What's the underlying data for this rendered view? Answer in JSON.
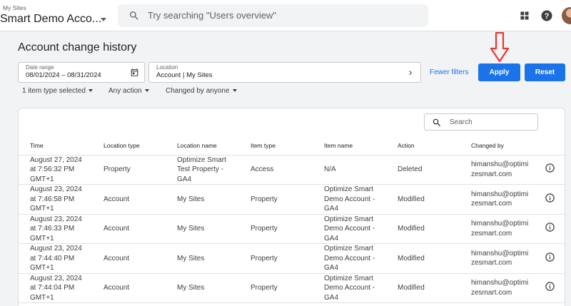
{
  "topbar": {
    "account_label": "My Sites",
    "account_name": "Smart Demo Acco...",
    "search_placeholder": "Try searching \"Users overview\""
  },
  "page": {
    "title": "Account change history"
  },
  "filters": {
    "date_range_label": "Date range",
    "date_range_value": "08/01/2024 – 08/31/2024",
    "location_label": "Location",
    "location_value": "Account | My Sites",
    "fewer_filters": "Fewer filters",
    "apply": "Apply",
    "reset": "Reset",
    "chips": [
      "1 item type selected",
      "Any action",
      "Changed by anyone"
    ]
  },
  "table": {
    "search_placeholder": "Search",
    "columns": [
      "Time",
      "Location type",
      "Location name",
      "Item type",
      "Item name",
      "Action",
      "Changed by"
    ],
    "rows": [
      {
        "time": [
          "August 27, 2024",
          "at 7:56:32 PM",
          "GMT+1"
        ],
        "location_type": "Property",
        "location_name": [
          "Optimize Smart",
          "Test Property -",
          "GA4"
        ],
        "item_type": "Access",
        "item_name": [
          "N/A"
        ],
        "action": "Deleted",
        "changed_by": [
          "himanshu@optimi",
          "zesmart.com"
        ]
      },
      {
        "time": [
          "August 23, 2024",
          "at 7:46:58 PM",
          "GMT+1"
        ],
        "location_type": "Account",
        "location_name": [
          "My Sites"
        ],
        "item_type": "Property",
        "item_name": [
          "Optimize Smart",
          "Demo Account -",
          "GA4"
        ],
        "action": "Modified",
        "changed_by": [
          "himanshu@optimi",
          "zesmart.com"
        ]
      },
      {
        "time": [
          "August 23, 2024",
          "at 7:46:33 PM",
          "GMT+1"
        ],
        "location_type": "Account",
        "location_name": [
          "My Sites"
        ],
        "item_type": "Property",
        "item_name": [
          "Optimize Smart",
          "Demo Account -",
          "GA4"
        ],
        "action": "Modified",
        "changed_by": [
          "himanshu@optimi",
          "zesmart.com"
        ]
      },
      {
        "time": [
          "August 23, 2024",
          "at 7:44:40 PM",
          "GMT+1"
        ],
        "location_type": "Account",
        "location_name": [
          "My Sites"
        ],
        "item_type": "Property",
        "item_name": [
          "Optimize Smart",
          "Demo Account -",
          "GA4"
        ],
        "action": "Modified",
        "changed_by": [
          "himanshu@optimi",
          "zesmart.com"
        ]
      },
      {
        "time": [
          "August 23, 2024",
          "at 7:44:04 PM",
          "GMT+1"
        ],
        "location_type": "Account",
        "location_name": [
          "My Sites"
        ],
        "item_type": "Property",
        "item_name": [
          "Optimize Smart",
          "Demo Account -",
          "GA4"
        ],
        "action": "Modified",
        "changed_by": [
          "himanshu@optimi",
          "zesmart.com"
        ]
      }
    ]
  },
  "icons": {
    "search": "search-icon",
    "apps": "apps-grid-icon",
    "help": "help-icon",
    "calendar": "calendar-icon",
    "chevron": "chevron-right-icon",
    "info": "info-icon",
    "annotation_arrow": "down-arrow-annotation-icon"
  },
  "colors": {
    "primary": "#1a73e8",
    "annotation": "#e53935"
  }
}
